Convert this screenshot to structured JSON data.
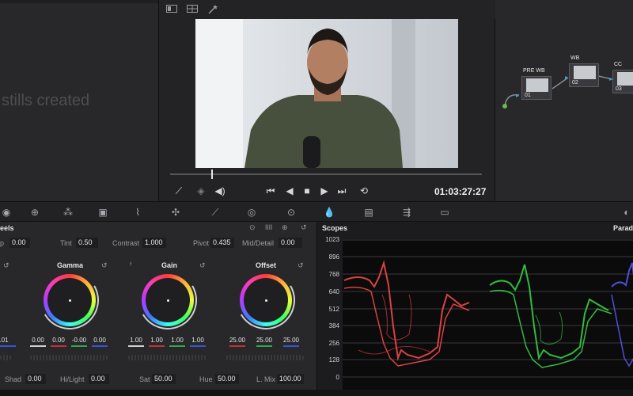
{
  "gallery": {
    "empty_text": "stills created"
  },
  "viewer": {
    "timecode": "01:03:27:27",
    "toolbar_icons": [
      "viewer-mode-icon",
      "split-screen-icon",
      "magic-wand-icon"
    ]
  },
  "nodes": [
    {
      "label": "PRE WB",
      "number": "01"
    },
    {
      "label": "WB",
      "number": "02"
    },
    {
      "label": "CC",
      "number": "03"
    }
  ],
  "wheels_panel": {
    "title": "eels",
    "params_top": [
      {
        "label": "p",
        "value": "0.00"
      },
      {
        "label": "Tint",
        "value": "0.50"
      },
      {
        "label": "Contrast",
        "value": "1.000"
      },
      {
        "label": "Pivot",
        "value": "0.435"
      },
      {
        "label": "Mid/Detail",
        "value": "0.00"
      }
    ],
    "wheels": [
      {
        "title": "Gamma",
        "values": [
          "0.00",
          "0.00",
          "-0.00",
          "0.00"
        ]
      },
      {
        "title": "Gain",
        "values": [
          "1.00",
          "1.00",
          "1.00",
          "1.00"
        ]
      },
      {
        "title": "Offset",
        "values": [
          "25.00",
          "25.00",
          "25.00"
        ]
      }
    ],
    "lift_partial_value": ".01",
    "params_bottom": [
      {
        "label": "Shad",
        "value": "0.00"
      },
      {
        "label": "Hi/Light",
        "value": "0.00"
      },
      {
        "label": "Sat",
        "value": "50.00"
      },
      {
        "label": "Hue",
        "value": "50.00"
      },
      {
        "label": "L. Mix",
        "value": "100.00"
      }
    ]
  },
  "scopes": {
    "title": "Scopes",
    "mode": "Parad",
    "y_ticks": [
      "1023",
      "896",
      "768",
      "640",
      "512",
      "384",
      "256",
      "128",
      "0"
    ]
  },
  "colors": {
    "red_trace": "#ff4b4b",
    "green_trace": "#3bd94a",
    "blue_trace": "#5a5cff",
    "value_red": "#c0313a",
    "value_green": "#2fa84a",
    "value_blue": "#3356d6"
  }
}
